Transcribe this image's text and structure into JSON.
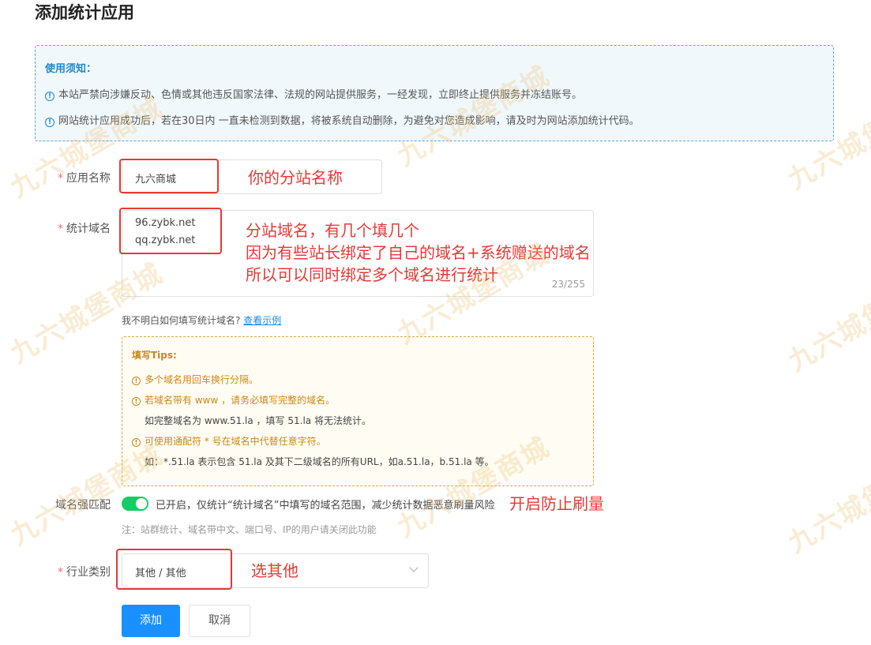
{
  "page": {
    "title": "添加统计应用"
  },
  "notice": {
    "title": "使用须知：",
    "lines": [
      "本站严禁向涉嫌反动、色情或其他违反国家法律、法规的网站提供服务，一经发现，立即终止提供服务并冻结账号。",
      "网站统计应用成功后，若在30日内 一直未检测到数据，将被系统自动删除，为避免对您造成影响，请及时为网站添加统计代码。"
    ]
  },
  "form": {
    "app_name": {
      "label": "应用名称",
      "value": "九六商城",
      "note": "你的分站名称"
    },
    "domains": {
      "label": "统计域名",
      "values": [
        "96.zybk.net",
        "qq.zybk.net"
      ],
      "counter": "23/255",
      "notes": [
        "分站域名，有几个填几个",
        "因为有些站长绑定了自己的域名+系统赠送的域名",
        "所以可以同时绑定多个域名进行统计"
      ],
      "help_prefix": "我不明白如何填写统计域名?",
      "help_link": "查看示例"
    },
    "tips": {
      "title": "填写Tips:",
      "lines": [
        "多个域名用回车换行分隔。",
        "若域名带有 www ，请务必填写完整的域名。",
        "如完整域名为 www.51.la ，填写 51.la 将无法统计。",
        "可使用通配符 * 号在域名中代替任意字符。",
        "如：*.51.la 表示包含 51.la 及其下二级域名的所有URL，如a.51.la，b.51.la 等。"
      ]
    },
    "strict_match": {
      "label": "域名强匹配",
      "enabled": true,
      "text": "已开启，仅统计“统计域名”中填写的域名范围，减少统计数据恶意刷量风险",
      "note": "开启防止刷量",
      "sub_note": "注：站群统计、域名带中文、端口号、IP的用户请关闭此功能"
    },
    "industry": {
      "label": "行业类别",
      "value": "其他 / 其他",
      "note": "选其他"
    },
    "required_mark": "*"
  },
  "buttons": {
    "add": "添加",
    "cancel": "取消"
  },
  "watermark": "九六城堡商城",
  "colors": {
    "primary": "#1890ff",
    "switch_on": "#13ce66",
    "annotation_red": "#e53935",
    "notice_blue": "#1e88c9",
    "tips_orange": "#c9881b"
  }
}
